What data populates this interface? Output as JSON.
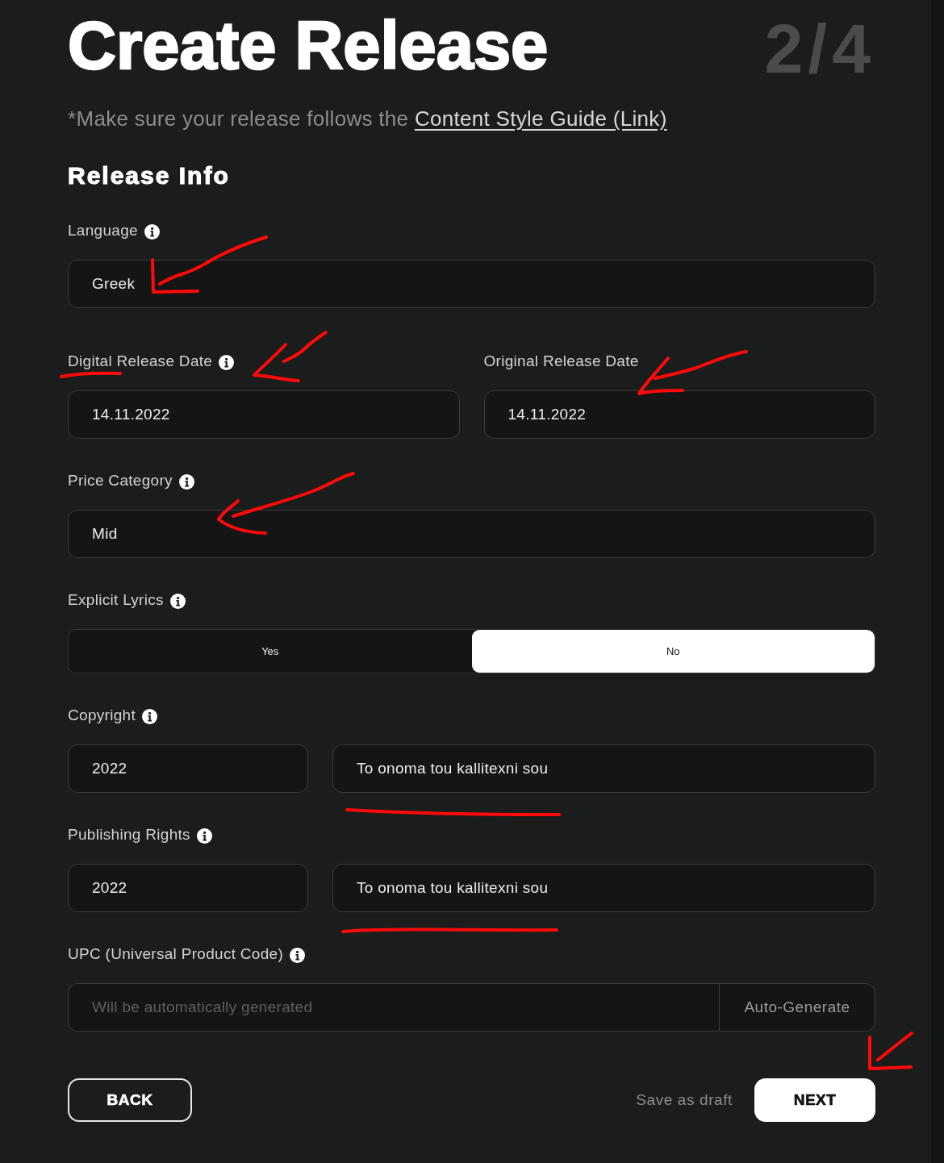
{
  "header": {
    "title": "Create Release",
    "step": "2/4"
  },
  "note": {
    "text": "*Make sure your release follows the ",
    "link": "Content Style Guide (Link)"
  },
  "section": {
    "title": "Release Info"
  },
  "rows": [
    {
      "kind": "field",
      "label": "Language",
      "info": true,
      "value": "Greek"
    },
    {
      "kind": "split",
      "items": [
        {
          "label": "Digital Release Date",
          "info": true,
          "value": "14.11.2022"
        },
        {
          "label": "Original Release Date",
          "info": false,
          "value": "14.11.2022"
        }
      ]
    },
    {
      "kind": "field",
      "label": "Price Category",
      "info": true,
      "value": "Mid"
    },
    {
      "kind": "toggle",
      "label": "Explicit Lyrics",
      "info": true,
      "options": [
        {
          "label": "Yes",
          "selected": false
        },
        {
          "label": "No",
          "selected": true
        }
      ]
    },
    {
      "kind": "year_name",
      "label": "Copyright",
      "info": true,
      "year": "2022",
      "name": "To onoma tou kallitexni sou"
    },
    {
      "kind": "year_name",
      "label": "Publishing Rights",
      "info": true,
      "year": "2022",
      "name": "To onoma tou kallitexni sou"
    },
    {
      "kind": "generate",
      "label": "UPC (Universal Product Code)",
      "info": true,
      "placeholder": "Will be automatically generated",
      "button": "Auto-Generate"
    }
  ],
  "footer": {
    "back": "BACK",
    "draft": "Save as draft",
    "next": "NEXT"
  }
}
